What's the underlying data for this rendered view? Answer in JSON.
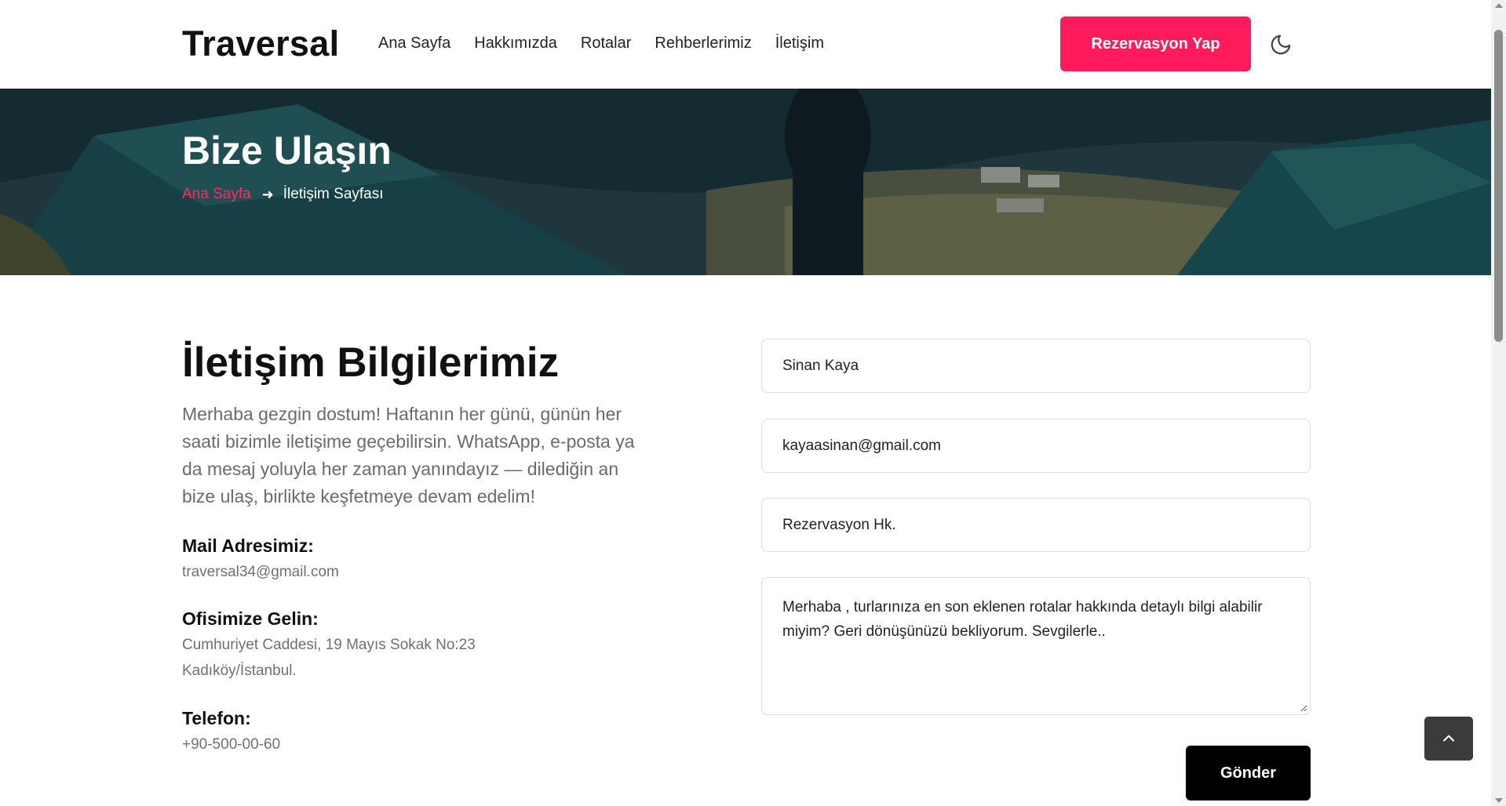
{
  "header": {
    "logo": "Traversal",
    "nav": [
      "Ana Sayfa",
      "Hakkımızda",
      "Rotalar",
      "Rehberlerimiz",
      "İletişim"
    ],
    "reserve_label": "Rezervasyon Yap",
    "theme_icon": "moon-icon"
  },
  "hero": {
    "title": "Bize Ulaşın",
    "breadcrumb_home": "Ana Sayfa",
    "breadcrumb_current": "İletişim Sayfası",
    "breadcrumb_icon": "arrow-right-icon"
  },
  "info": {
    "title": "İletişim Bilgilerimiz",
    "description": "Merhaba gezgin dostum! Haftanın her günü, günün her saati bizimle iletişime geçebilirsin. WhatsApp, e-posta ya da mesaj yoluyla her zaman yanındayız — dilediğin an bize ulaş, birlikte keşfetmeye devam edelim!",
    "mail_label": "Mail Adresimiz:",
    "mail_value": "traversal34@gmail.com",
    "office_label": "Ofisimize Gelin:",
    "office_line1": "Cumhuriyet Caddesi, 19 Mayıs Sokak No:23",
    "office_line2": "Kadıköy/İstanbul.",
    "phone_label": "Telefon:",
    "phone_value": "+90-500-00-60"
  },
  "form": {
    "name_value": "Sinan Kaya",
    "email_value": "kayaasinan@gmail.com",
    "subject_value": "Rezervasyon Hk.",
    "message_value": "Merhaba , turlarınıza en son eklenen rotalar hakkında detaylı bilgi alabilir miyim? Geri dönüşünüzü bekliyorum. Sevgilerle..",
    "send_label": "Gönder"
  },
  "colors": {
    "accent": "#ff1a5b",
    "dark_button": "#000000"
  }
}
